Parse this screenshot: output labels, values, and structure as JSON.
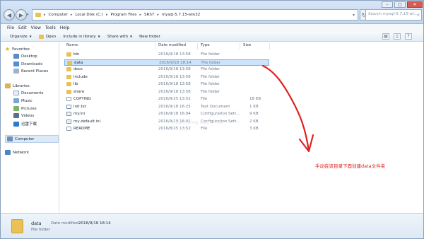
{
  "address": {
    "crumbs": [
      "Computer",
      "Local Disk (C:)",
      "Program Files",
      "SRS7",
      "mysql-5.7.15-win32"
    ]
  },
  "search": {
    "placeholder": "Search mysql-5.7.15-wi..."
  },
  "menu": [
    "File",
    "Edit",
    "View",
    "Tools",
    "Help"
  ],
  "toolbar": {
    "organize": "Organize",
    "open": "Open",
    "include": "Include in library",
    "share": "Share with",
    "new_folder": "New folder"
  },
  "nav": {
    "favorites": "Favorites",
    "desktop": "Desktop",
    "downloads": "Downloads",
    "recent": "Recent Places",
    "libraries": "Libraries",
    "documents": "Documents",
    "music": "Music",
    "pictures": "Pictures",
    "videos": "Videos",
    "thunder": "迅雷下载",
    "computer": "Computer",
    "network": "Network"
  },
  "columns": {
    "name": "Name",
    "date": "Date modified",
    "type": "Type",
    "size": "Size"
  },
  "files": [
    {
      "name": "bin",
      "date": "2016/9/18 13:58",
      "type": "File folder",
      "size": "",
      "icon": "folder"
    },
    {
      "name": "data",
      "date": "2016/9/18 18:14",
      "type": "File folder",
      "size": "",
      "icon": "folder"
    },
    {
      "name": "docs",
      "date": "2016/9/18 13:58",
      "type": "File folder",
      "size": "",
      "icon": "folder"
    },
    {
      "name": "include",
      "date": "2016/9/18 13:58",
      "type": "File folder",
      "size": "",
      "icon": "folder"
    },
    {
      "name": "lib",
      "date": "2016/9/18 13:58",
      "type": "File folder",
      "size": "",
      "icon": "folder"
    },
    {
      "name": "share",
      "date": "2016/9/18 13:58",
      "type": "File folder",
      "size": "",
      "icon": "folder"
    },
    {
      "name": "COPYING",
      "date": "2016/8/25 13:52",
      "type": "File",
      "size": "18 KB",
      "icon": "file"
    },
    {
      "name": "init.txt",
      "date": "2016/9/18 16:25",
      "type": "Text Document",
      "size": "1 KB",
      "icon": "txt"
    },
    {
      "name": "my.ini",
      "date": "2016/9/18 16:04",
      "type": "Configuration Sett...",
      "size": "9 KB",
      "icon": "cfg"
    },
    {
      "name": "my-default.ini",
      "date": "2016/9/18 16:01",
      "type": "Configuration Sett...",
      "size": "2 KB",
      "icon": "cfg"
    },
    {
      "name": "README",
      "date": "2016/8/25 13:52",
      "type": "File",
      "size": "3 KB",
      "icon": "file"
    }
  ],
  "selected_index": 1,
  "annotation": "手动在该目录下面创建data文件夹",
  "watermark": "http://blog.csdn.net/",
  "details": {
    "name": "data",
    "date_label": "Date modified:",
    "date_value": "2016/9/18 18:14",
    "type": "File folder"
  },
  "colors": {
    "annotation": "#e02020",
    "folder": "#e9c156",
    "selection": "#cce4fb"
  }
}
